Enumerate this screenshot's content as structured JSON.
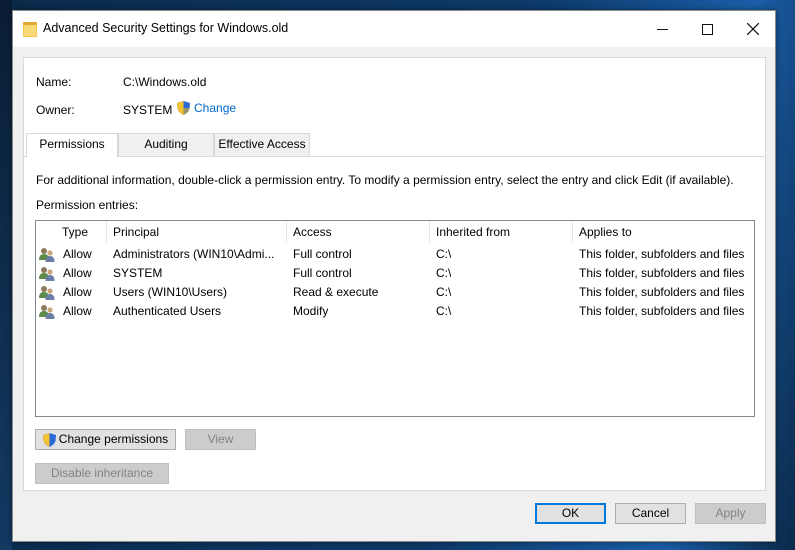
{
  "window": {
    "title": "Advanced Security Settings for Windows.old"
  },
  "object": {
    "name_label": "Name:",
    "name_value": "C:\\Windows.old",
    "owner_label": "Owner:",
    "owner_value": "SYSTEM",
    "change_link": "Change"
  },
  "tabs": [
    {
      "label": "Permissions",
      "active": true
    },
    {
      "label": "Auditing",
      "active": false
    },
    {
      "label": "Effective Access",
      "active": false
    }
  ],
  "info_text": "For additional information, double-click a permission entry. To modify a permission entry, select the entry and click Edit (if available).",
  "entries_label": "Permission entries:",
  "table": {
    "columns": [
      "Type",
      "Principal",
      "Access",
      "Inherited from",
      "Applies to"
    ],
    "rows": [
      {
        "type": "Allow",
        "principal": "Administrators (WIN10\\Admi...",
        "access": "Full control",
        "inherited": "C:\\",
        "applies": "This folder, subfolders and files"
      },
      {
        "type": "Allow",
        "principal": "SYSTEM",
        "access": "Full control",
        "inherited": "C:\\",
        "applies": "This folder, subfolders and files"
      },
      {
        "type": "Allow",
        "principal": "Users (WIN10\\Users)",
        "access": "Read & execute",
        "inherited": "C:\\",
        "applies": "This folder, subfolders and files"
      },
      {
        "type": "Allow",
        "principal": "Authenticated Users",
        "access": "Modify",
        "inherited": "C:\\",
        "applies": "This folder, subfolders and files"
      }
    ]
  },
  "buttons": {
    "change_permissions": "Change permissions",
    "view": "View",
    "disable_inheritance": "Disable inheritance",
    "ok": "OK",
    "cancel": "Cancel",
    "apply": "Apply"
  },
  "icons": {
    "title": "folder-icon",
    "shield": "uac-shield-icon",
    "principal": "user-group-icon"
  },
  "colors": {
    "link": "#0066cc",
    "default_button_border": "#0078d7",
    "disabled_text": "#838383"
  }
}
